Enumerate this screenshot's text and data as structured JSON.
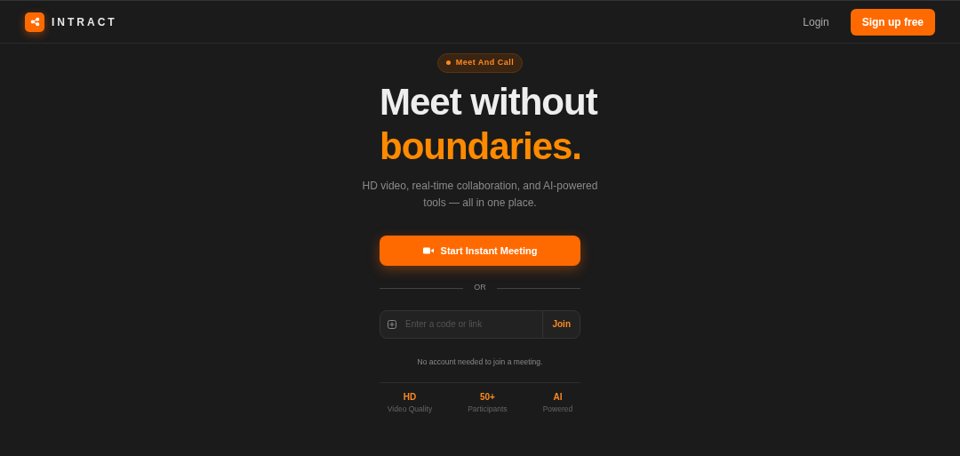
{
  "navbar": {
    "brand": "INTRACT",
    "login": "Login",
    "signup": "Sign up free"
  },
  "hero": {
    "badge": "Meet And Call",
    "title": "Meet without",
    "title_accent": "boundaries.",
    "subtitle": "HD video, real-time collaboration, and AI-powered tools — all in one place.",
    "start_button": "Start Instant Meeting",
    "divider": "OR",
    "join": {
      "placeholder": "Enter a code or link",
      "button": "Join"
    },
    "note": "No account needed to join a meeting."
  },
  "stats": [
    {
      "value": "HD",
      "label": "Video Quality"
    },
    {
      "value": "50+",
      "label": "Participants"
    },
    {
      "value": "AI",
      "label": "Powered"
    }
  ]
}
